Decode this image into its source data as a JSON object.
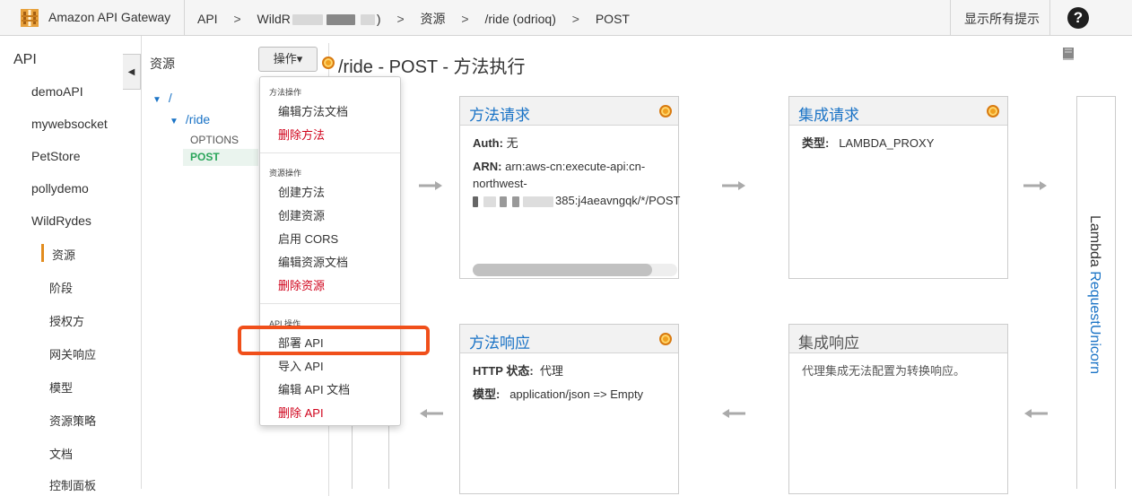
{
  "topbar": {
    "app_title": "Amazon API Gateway",
    "crumb_api": "API",
    "crumb_sep": ">",
    "crumb_apiname_visible": "WildR",
    "crumb_apiname_tail": ")",
    "crumb_resources": "资源",
    "crumb_resource": "/ride (odrioq)",
    "crumb_method": "POST",
    "hints_label": "显示所有提示",
    "help_label": "?"
  },
  "leftnav": {
    "root": "API",
    "apis": [
      "demoAPI",
      "mywebsocket",
      "PetStore",
      "pollydemo",
      "WildRydes"
    ],
    "sub_items": [
      "资源",
      "阶段",
      "授权方",
      "网关响应",
      "模型",
      "资源策略",
      "文档",
      "控制面板"
    ],
    "active_index": 0,
    "collapse_icon": "◀"
  },
  "resources": {
    "header": "资源",
    "actions_label": "操作▾",
    "tree_root": "/",
    "tree_child": "/ride",
    "methods": [
      "OPTIONS",
      "POST"
    ],
    "selected_method": "POST"
  },
  "actions_menu": {
    "groups": [
      {
        "title": "方法操作",
        "items": [
          {
            "label": "编辑方法文档",
            "danger": false
          },
          {
            "label": "删除方法",
            "danger": true
          }
        ]
      },
      {
        "title": "资源操作",
        "items": [
          {
            "label": "创建方法",
            "danger": false
          },
          {
            "label": "创建资源",
            "danger": false
          },
          {
            "label": "启用 CORS",
            "danger": false
          },
          {
            "label": "编辑资源文档",
            "danger": false
          },
          {
            "label": "删除资源",
            "danger": true
          }
        ]
      },
      {
        "title": "API 操作",
        "items": [
          {
            "label": "部署 API",
            "danger": false,
            "highlighted": true
          },
          {
            "label": "导入 API",
            "danger": false
          },
          {
            "label": "编辑 API 文档",
            "danger": false
          },
          {
            "label": "删除 API",
            "danger": true
          }
        ]
      }
    ]
  },
  "main": {
    "title": "/ride - POST - 方法执行",
    "method_request": {
      "title": "方法请求",
      "auth_label": "Auth:",
      "auth_value": "无",
      "arn_label": "ARN:",
      "arn_line1": "arn:aws-cn:execute-api:cn-",
      "arn_line2": "northwest-",
      "arn_line3": "385:j4aeavngqk/*/POST"
    },
    "integration_request": {
      "title": "集成请求",
      "type_label": "类型:",
      "type_value": "LAMBDA_PROXY"
    },
    "method_response": {
      "title": "方法响应",
      "status_label": "HTTP 状态:",
      "status_value": "代理",
      "model_label": "模型:",
      "model_value": "application/json => Empty"
    },
    "integration_response": {
      "title": "集成响应",
      "body": "代理集成无法配置为转换响应。"
    },
    "lambda": {
      "prefix": "Lambda",
      "function": "RequestUnicorn"
    }
  },
  "colors": {
    "accent_blue": "#1a73c6",
    "danger_red": "#d0021b",
    "highlight_orange": "#f04f1a",
    "active_orange": "#e28c1e",
    "method_green": "#2aa55a"
  },
  "icons": [
    "aws-logo-icon",
    "help-icon",
    "collapse-icon",
    "orange-dot-icon",
    "book-icon",
    "arrow-right-icon",
    "arrow-left-icon"
  ]
}
